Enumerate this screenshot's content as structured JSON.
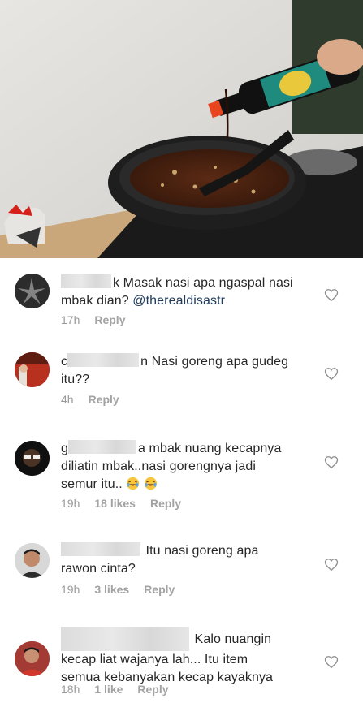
{
  "comments": [
    {
      "username_suffix": "k",
      "text_line1": "Masak nasi apa ngaspal nasi",
      "text_line2_pre": "mbak dian? ",
      "mention": "@therealdisastr",
      "time": "17h",
      "likes": "",
      "reply": "Reply"
    },
    {
      "username_prefix": "c",
      "username_suffix": "n",
      "text_line1": "Nasi goreng apa gudeg",
      "text_line2": "itu??",
      "time": "4h",
      "likes": "",
      "reply": "Reply"
    },
    {
      "username_prefix": "g",
      "text_line1": "a mbak nuang kecapnya",
      "text_line2": "diliatin mbak..nasi gorengnya jadi",
      "text_line3": "semur itu..",
      "emojis": [
        "face-with-tears-of-joy",
        "face-with-tears-of-joy"
      ],
      "time": "19h",
      "likes": "18 likes",
      "reply": "Reply"
    },
    {
      "text_line1": "Itu nasi goreng apa",
      "text_line2": "rawon cinta?",
      "time": "19h",
      "likes": "3 likes",
      "reply": "Reply"
    },
    {
      "username_prefix": "",
      "text_line1": "Kalo nuangin",
      "text_line2": "kecap liat wajanya lah... Itu item",
      "text_line3": "semua kebanyakan kecap kayaknya",
      "time": "18h",
      "likes": "1 like",
      "reply": "Reply"
    }
  ],
  "icons": {
    "like": "heart-outline-icon"
  },
  "colors": {
    "text": "#262626",
    "meta": "#999999",
    "mention": "#1f3a5a"
  }
}
